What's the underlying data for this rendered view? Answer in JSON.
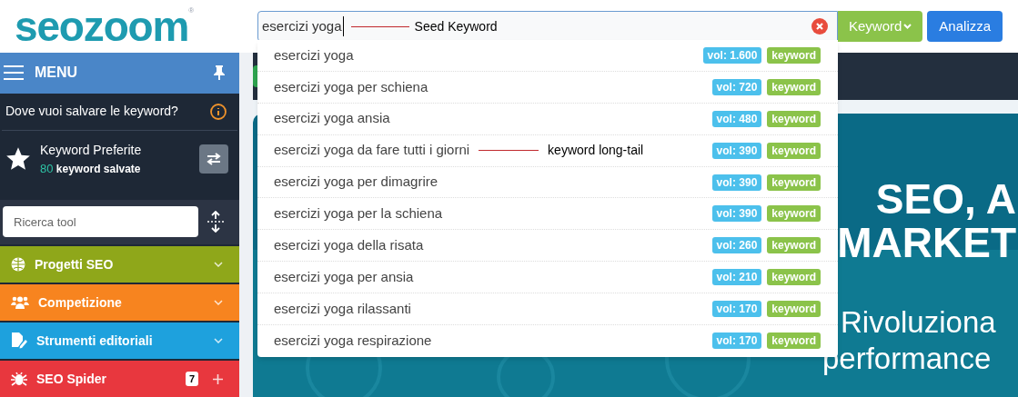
{
  "logo": {
    "text": "seozoom",
    "mark": "®"
  },
  "search": {
    "value": "esercizi yoga",
    "annotation": "Seed Keyword"
  },
  "type_button": {
    "label": "Keyword"
  },
  "analyze_button": {
    "label": "Analizza"
  },
  "suggestions": [
    {
      "text": "esercizi yoga",
      "volume": "vol: 1.600",
      "tag": "keyword"
    },
    {
      "text": "esercizi yoga per schiena",
      "volume": "vol: 720",
      "tag": "keyword"
    },
    {
      "text": "esercizi yoga ansia",
      "volume": "vol: 480",
      "tag": "keyword"
    },
    {
      "text": "esercizi yoga da fare tutti i giorni",
      "volume": "vol: 390",
      "tag": "keyword",
      "annotation": "keyword long-tail"
    },
    {
      "text": "esercizi yoga per dimagrire",
      "volume": "vol: 390",
      "tag": "keyword"
    },
    {
      "text": "esercizi yoga per la schiena",
      "volume": "vol: 390",
      "tag": "keyword"
    },
    {
      "text": "esercizi yoga della risata",
      "volume": "vol: 260",
      "tag": "keyword"
    },
    {
      "text": "esercizi yoga per ansia",
      "volume": "vol: 210",
      "tag": "keyword"
    },
    {
      "text": "esercizi yoga rilassanti",
      "volume": "vol: 170",
      "tag": "keyword"
    },
    {
      "text": "esercizi yoga respirazione",
      "volume": "vol: 170",
      "tag": "keyword"
    }
  ],
  "sidebar": {
    "title": "MENU",
    "save_prompt": "Dove vuoi salvare le keyword?",
    "favorites": {
      "title": "Keyword Preferite",
      "count": "80",
      "caption": "keyword salvate"
    },
    "tool_search": {
      "placeholder": "Ricerca tool"
    },
    "sections": [
      {
        "label": "Progetti SEO",
        "color": "#8fa71a",
        "kind": "globe",
        "collapsible": true
      },
      {
        "label": "Competizione",
        "color": "#f7841f",
        "kind": "users",
        "collapsible": true
      },
      {
        "label": "Strumenti editoriali",
        "color": "#1ea1dd",
        "kind": "edit",
        "collapsible": true
      },
      {
        "label": "SEO Spider",
        "color": "#e8373e",
        "kind": "bug",
        "collapsible": false,
        "badge": "7"
      }
    ]
  },
  "banner": {
    "kind": "picture",
    "headline": [
      "SEO, A",
      "MARKET"
    ],
    "subtitle": [
      "Rivoluziona",
      "performance"
    ]
  }
}
